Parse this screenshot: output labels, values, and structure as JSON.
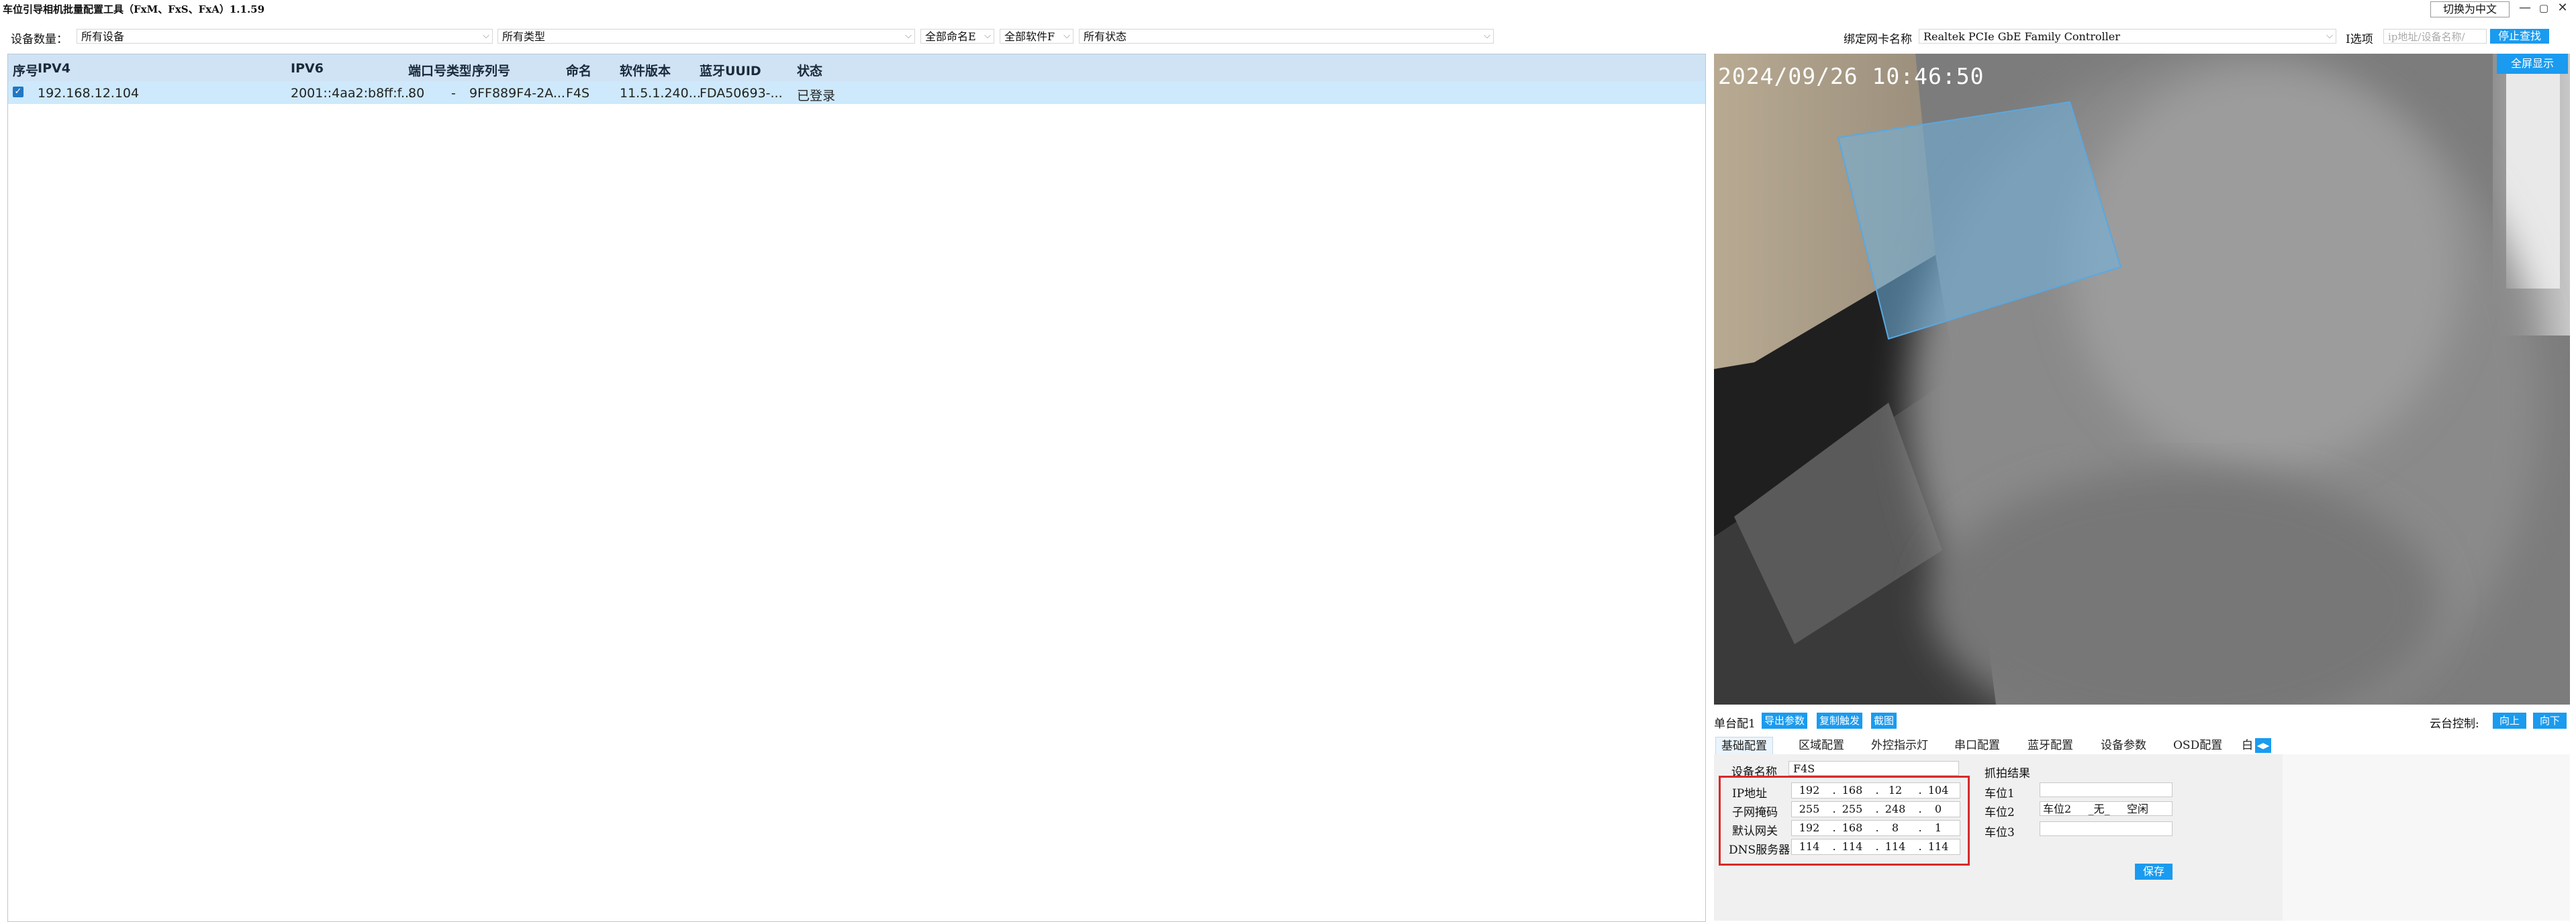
{
  "window": {
    "title": "车位引导相机批量配置工具（FxM、FxS、FxA）1.1.59",
    "lang_button": "切换为中文",
    "controls": {
      "minimize": "—",
      "maximize": "▢",
      "close": "✕"
    }
  },
  "filters": {
    "device_count_label": "设备数量：",
    "device_filter": "所有设备",
    "type_filter": "所有类型",
    "name_filter": "全部命名E",
    "software_filter": "全部软件F",
    "status_filter": "所有状态"
  },
  "nic": {
    "label": "绑定网卡名称",
    "value": "Realtek PCIe GbE Family Controller",
    "option_label": "I选项",
    "search_placeholder": "ip地址/设备名称/",
    "stop_button": "停止查找"
  },
  "table": {
    "columns": [
      "序号",
      "IPV4",
      "IPV6",
      "端口号",
      "类型",
      "序列号",
      "命名",
      "软件版本",
      "蓝牙UUID",
      "状态"
    ],
    "rows": [
      {
        "checked": true,
        "ipv4": "192.168.12.104",
        "ipv6": "2001::4aa2:b8ff:f...",
        "port": "80",
        "type": "-",
        "serial": "9FF889F4-2A...",
        "name": "F4S",
        "version": "11.5.1.240...",
        "uuid": "FDA50693-...",
        "status": "已登录"
      }
    ]
  },
  "video": {
    "timestamp": "2024/09/26 10:46:50",
    "fullscreen_button": "全屏显示"
  },
  "controls_row": {
    "single_label": "单台配1",
    "export_button": "导出参数",
    "copy_button": "复制触发",
    "capture_button": "截图",
    "ptz_label": "云台控制:",
    "up_button": "向上",
    "down_button": "向下"
  },
  "tabs": [
    "基础配置",
    "区域配置",
    "外控指示灯",
    "串口配置",
    "蓝牙配置",
    "设备参数",
    "OSD配置",
    "白"
  ],
  "basic": {
    "device_name_label": "设备名称",
    "device_name": "F4S",
    "ip_label": "IP地址",
    "ip": [
      "192",
      "168",
      "12",
      "104"
    ],
    "mask_label": "子网掩码",
    "mask": [
      "255",
      "255",
      "248",
      "0"
    ],
    "gateway_label": "默认网关",
    "gateway": [
      "192",
      "168",
      "8",
      "1"
    ],
    "dns_label": "DNS服务器",
    "dns": [
      "114",
      "114",
      "114",
      "114"
    ]
  },
  "capture": {
    "title": "抓拍结果",
    "slot1_label": "车位1",
    "slot1_value": "",
    "slot2_label": "车位2",
    "slot2_value": "车位2     _无_     空闲",
    "slot3_label": "车位3",
    "slot3_value": "",
    "save_button": "保存"
  },
  "colors": {
    "accent": "#1a9bef",
    "header_bg": "#cfe3f5",
    "selected_row": "#cde9fb",
    "highlight_border": "#d82a2a"
  }
}
